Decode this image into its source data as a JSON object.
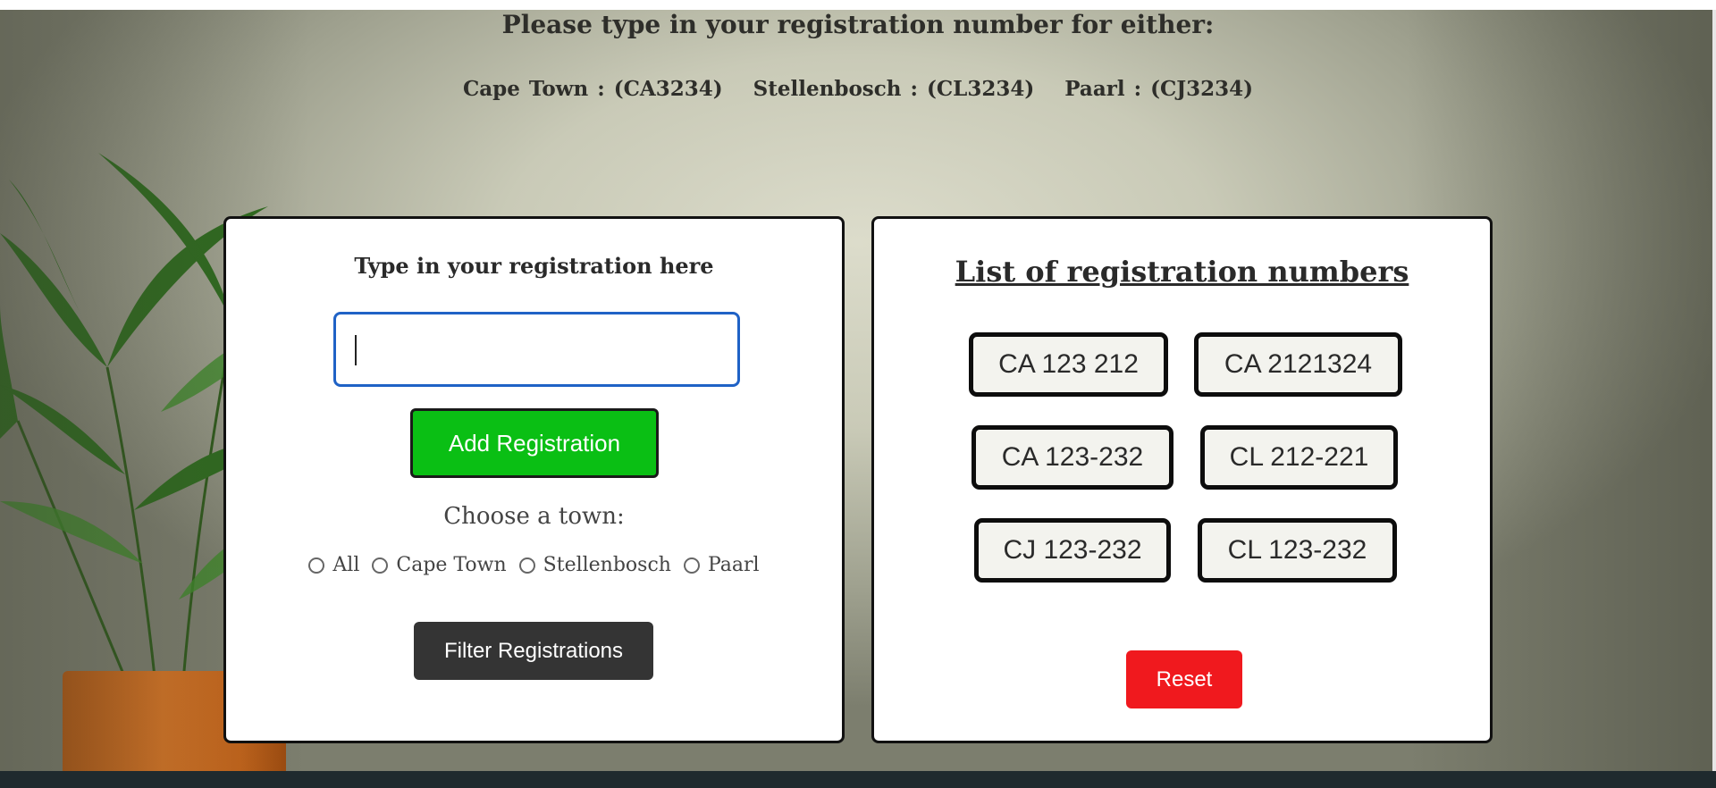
{
  "page": {
    "title": "Please type in your registration number for either:",
    "towns": [
      "Cape Town : (CA3234)",
      "Stellenbosch : (CL3234)",
      "Paarl : (CJ3234)"
    ]
  },
  "form": {
    "title": "Type in your registration here",
    "input_value": "",
    "add_label": "Add Registration",
    "choose_label": "Choose a town:",
    "radio_options": [
      "All",
      "Cape Town",
      "Stellenbosch",
      "Paarl"
    ],
    "filter_label": "Filter Registrations"
  },
  "list": {
    "title": "List of registration numbers",
    "plates": [
      "CA 123 212",
      "CA 2121324",
      "CA 123-232",
      "CL 212-221",
      "CJ 123-232",
      "CL 123-232"
    ],
    "reset_label": "Reset"
  },
  "colors": {
    "add_button": "#0abf14",
    "reset_button": "#f0191e",
    "filter_button": "#343434",
    "input_border": "#1f62c6"
  }
}
